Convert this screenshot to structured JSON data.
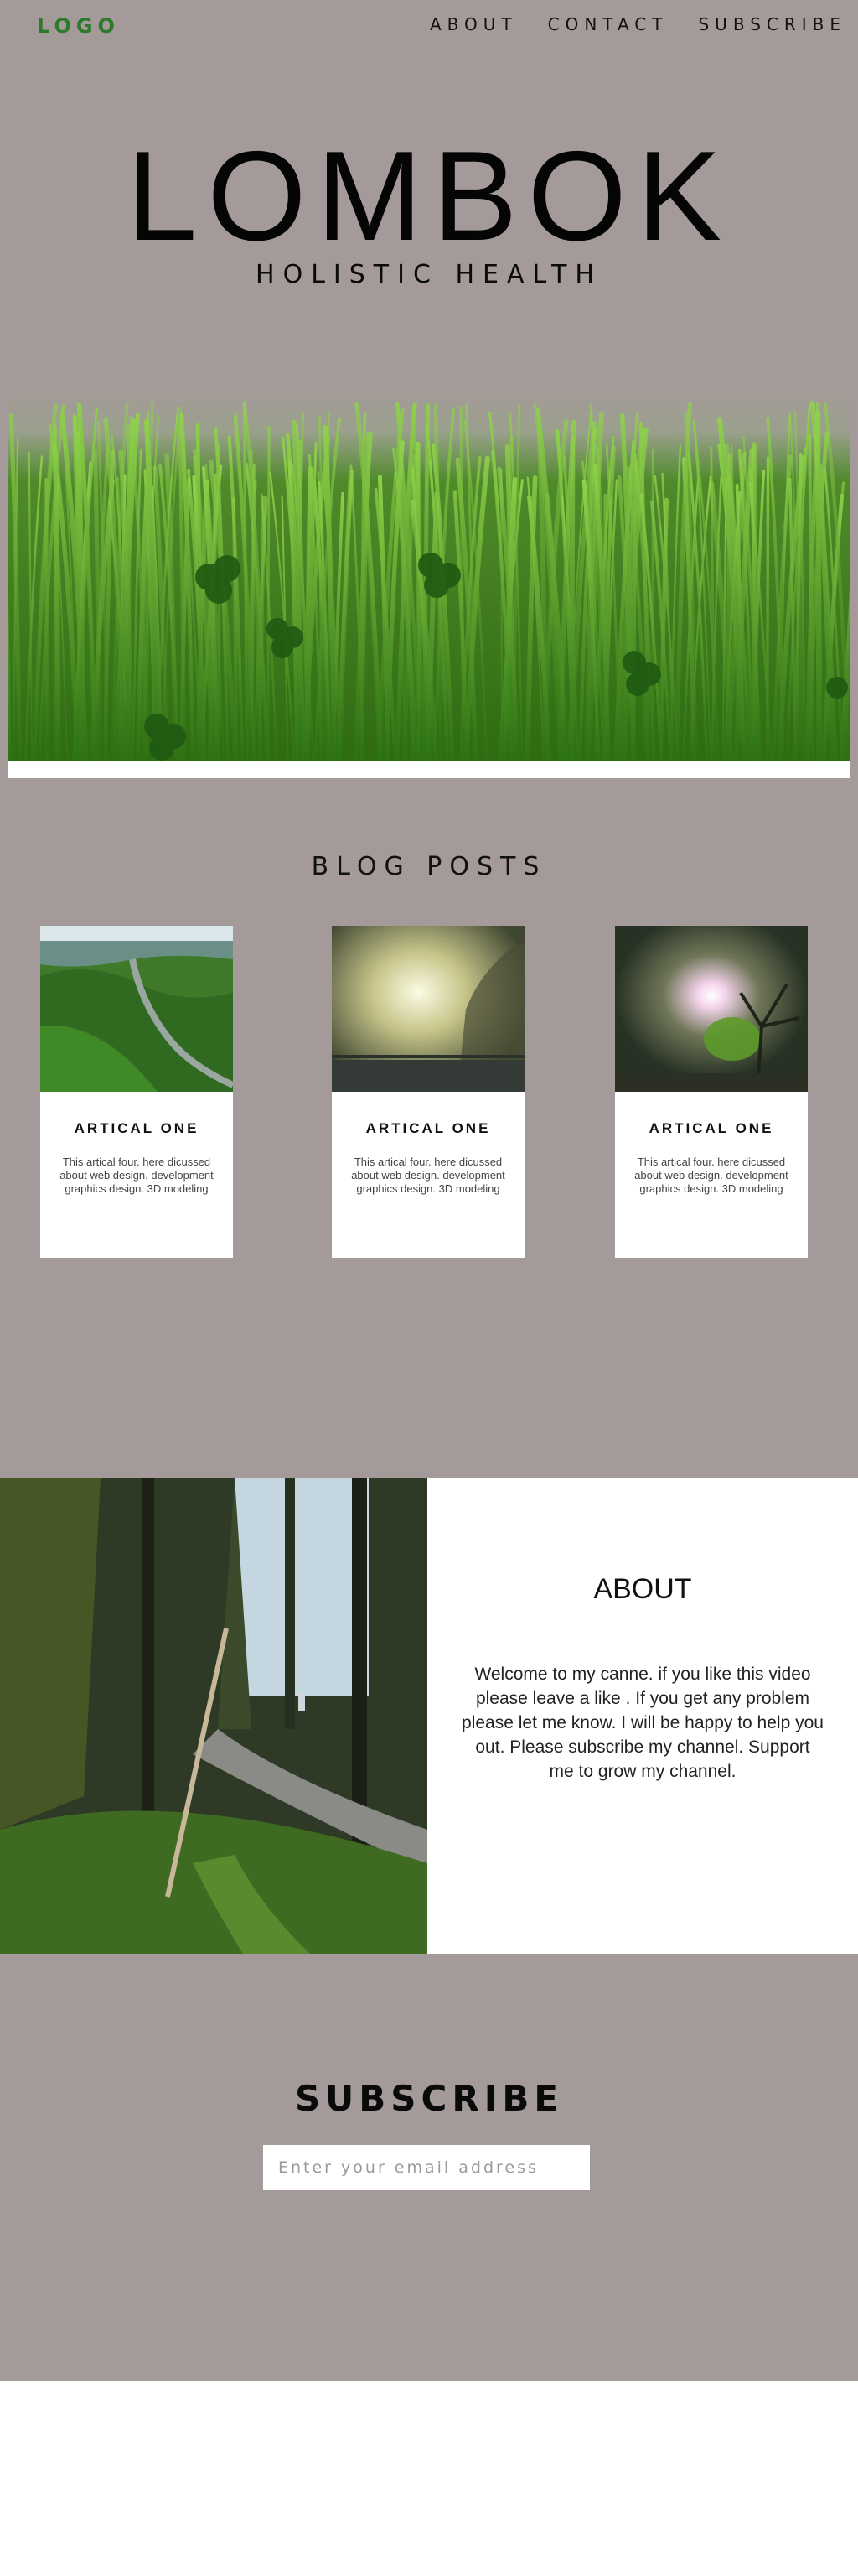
{
  "header": {
    "logo": "LOGO",
    "nav": [
      "ABOUT",
      "CONTACT",
      "SUBSCRIBE"
    ]
  },
  "hero": {
    "title": "LOMBOK",
    "subtitle": "HOLISTIC HEALTH",
    "banner_icon": "grass-clover-image"
  },
  "blog": {
    "heading": "BLOG POSTS",
    "posts": [
      {
        "title": "ARTICAL ONE",
        "text": "This artical four. here dicussed about  web design. development graphics design. 3D modeling",
        "image": "forest-valley-image"
      },
      {
        "title": "ARTICAL ONE",
        "text": "This artical four. here dicussed about  web design. development graphics design. 3D modeling",
        "image": "misty-sky-tree-image"
      },
      {
        "title": "ARTICAL ONE",
        "text": "This artical four. here dicussed about  web design. development graphics design. 3D modeling",
        "image": "sun-flare-tree-image"
      }
    ]
  },
  "about": {
    "heading": "ABOUT",
    "text": "Welcome to my canne. if you like this video please leave a like . If you get any problem please let me know. I will be happy to help you out. Please subscribe my channel. Support me to grow my channel.",
    "image": "forest-path-image"
  },
  "subscribe": {
    "heading": "SUBSCRIBE",
    "placeholder": "Enter your email address",
    "value": ""
  },
  "colors": {
    "background": "#a59a9a",
    "logo": "#2c7a2a",
    "panel": "#ffffff",
    "text": "#111111"
  }
}
